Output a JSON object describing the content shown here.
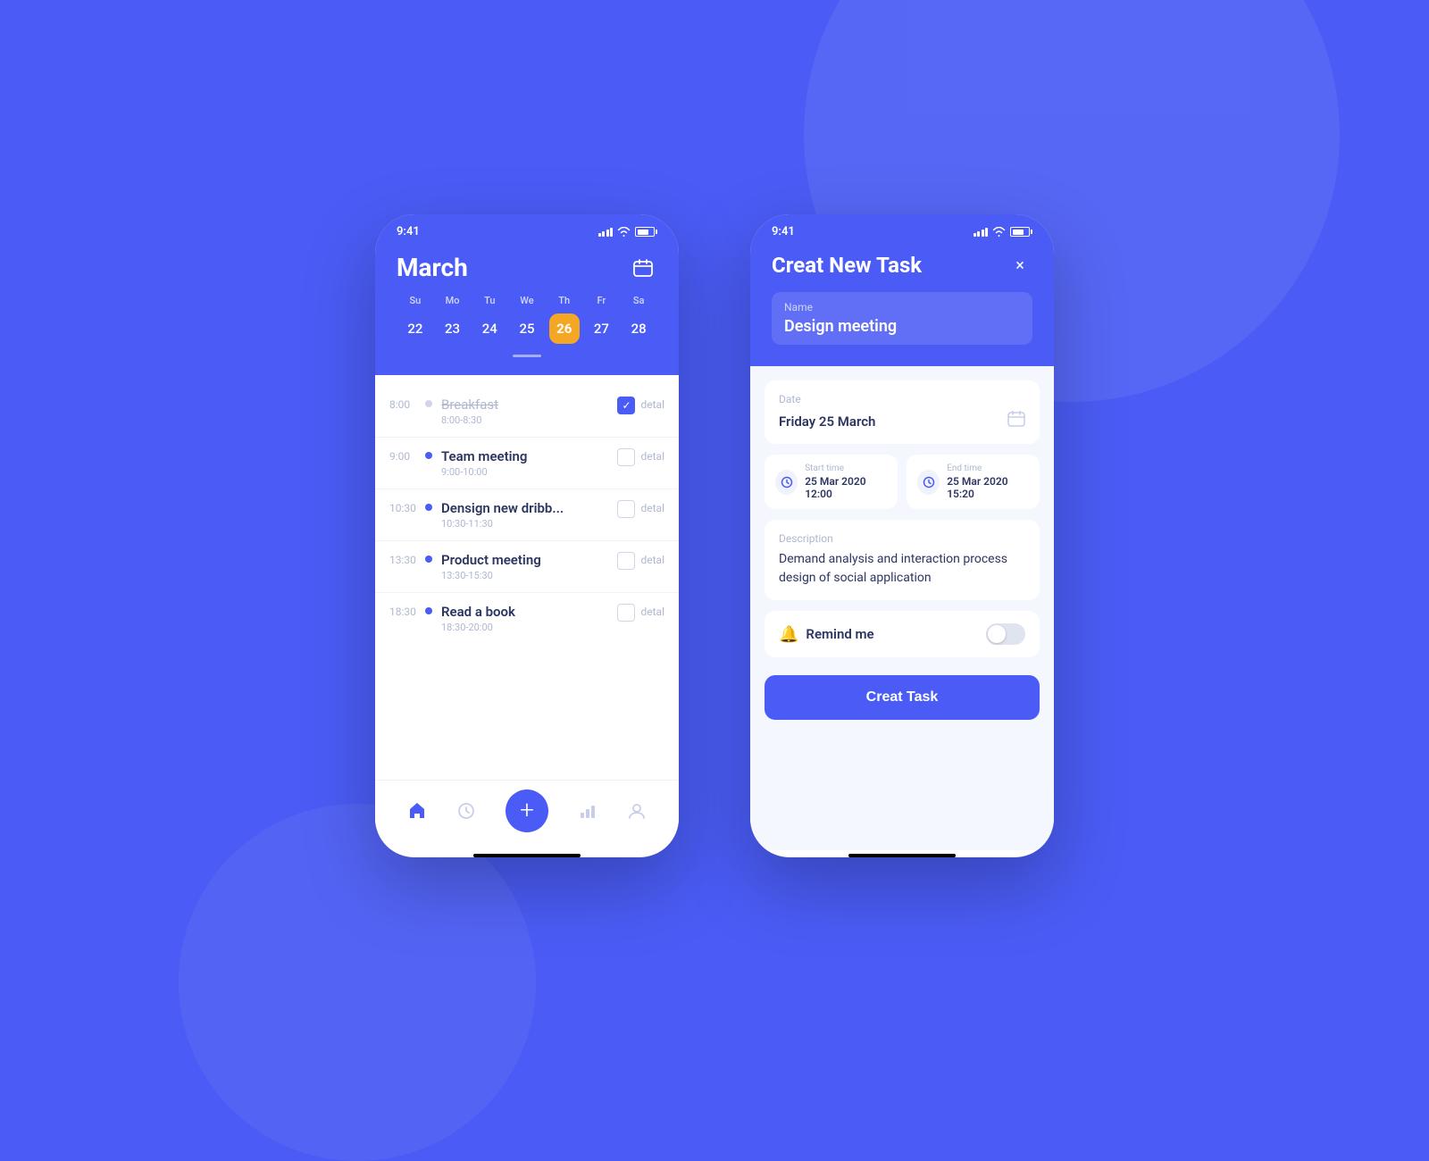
{
  "background": {
    "color": "#4a5cf5"
  },
  "phone1": {
    "status_bar": {
      "time": "9:41"
    },
    "calendar": {
      "month": "March",
      "week_days": [
        "Su",
        "Mo",
        "Tu",
        "We",
        "Th",
        "Fr",
        "Sa"
      ],
      "dates": [
        "22",
        "23",
        "24",
        "25",
        "26",
        "27",
        "28"
      ],
      "active_date": "26"
    },
    "tasks": [
      {
        "time": "8:00",
        "name": "Breakfast",
        "range": "8:00-8:30",
        "checked": true,
        "completed": true,
        "dot_empty": true
      },
      {
        "time": "9:00",
        "name": "Team meeting",
        "range": "9:00-10:00",
        "checked": false,
        "completed": false,
        "dot_empty": false
      },
      {
        "time": "10:30",
        "name": "Densign new dribb...",
        "range": "10:30-11:30",
        "checked": false,
        "completed": false,
        "dot_empty": false
      },
      {
        "time": "13:30",
        "name": "Product meeting",
        "range": "13:30-15:30",
        "checked": false,
        "completed": false,
        "dot_empty": false
      },
      {
        "time": "18:30",
        "name": "Read a book",
        "range": "18:30-20:00",
        "checked": false,
        "completed": false,
        "dot_empty": false
      }
    ],
    "nav": {
      "items": [
        "home",
        "clock",
        "plus",
        "chart",
        "profile"
      ]
    }
  },
  "phone2": {
    "status_bar": {
      "time": "9:41"
    },
    "header": {
      "title": "Creat New Task",
      "close_label": "×"
    },
    "name_field": {
      "label": "Name",
      "value": "Design meeting"
    },
    "date_field": {
      "label": "Date",
      "value": "Friday 25 March"
    },
    "start_time": {
      "label": "Start time",
      "value": "25 Mar 2020  12:00"
    },
    "end_time": {
      "label": "End time",
      "value": "25 Mar 2020  15:20"
    },
    "description": {
      "label": "Description",
      "value": "Demand analysis and interaction process design of social application"
    },
    "remind": {
      "label": "Remind me"
    },
    "create_button": {
      "label": "Creat Task"
    }
  }
}
